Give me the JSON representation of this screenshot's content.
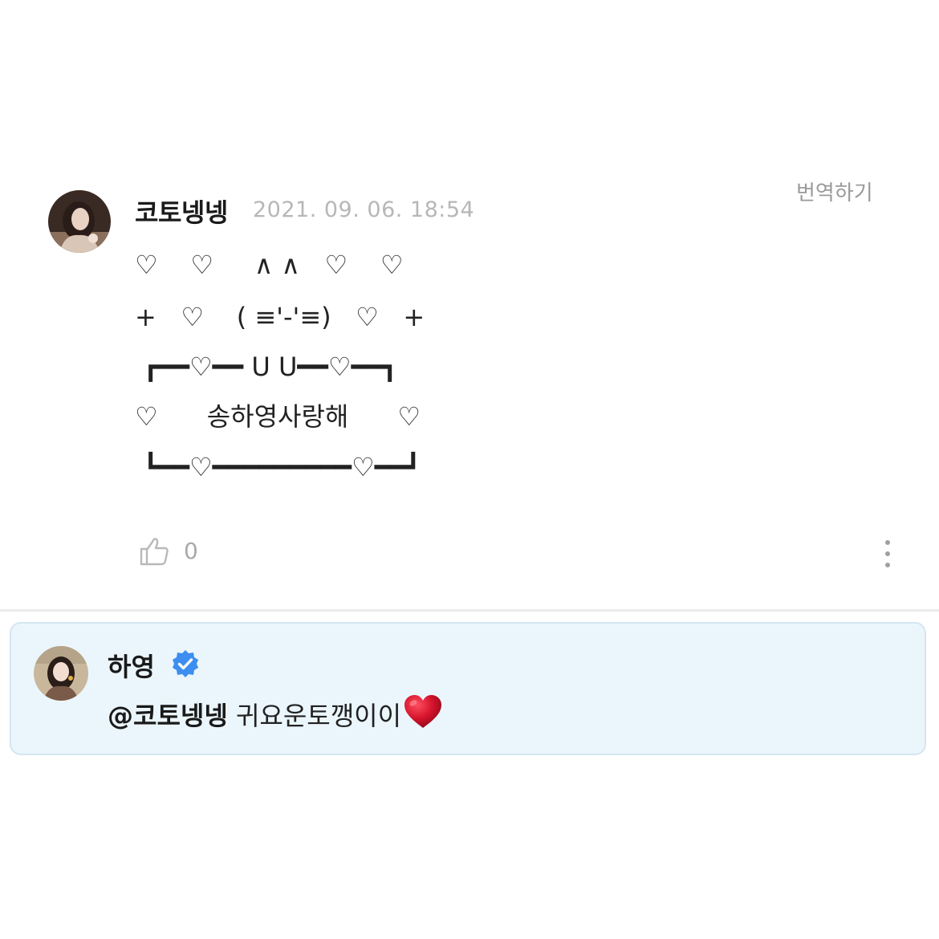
{
  "comment": {
    "author": "코토넹넹",
    "timestamp": "2021. 09. 06. 18:54",
    "translate_label": "번역하기",
    "art_lines": [
      "♡    ♡     ∧ ∧   ♡    ♡",
      "+   ♡    ( ≡'-'≡)   ♡   +",
      " ┏━━♡━━ U U━━♡━━┓",
      "♡      송하영사랑해      ♡",
      " ┗━━♡━━━━━━━━━♡━━┛"
    ],
    "like_count": "0",
    "icons": {
      "like": "thumbs-up-icon",
      "more": "more-vertical-icon"
    }
  },
  "reply": {
    "author": "하영",
    "verified": true,
    "mention": "@코토넹넹",
    "text": " 귀요운토깽이이",
    "emoji": "red-heart-icon",
    "colors": {
      "card_bg": "#ebf6fc",
      "card_border": "#d3e6f1",
      "verified": "#3d8ef0",
      "heart": "#c8102e"
    }
  }
}
